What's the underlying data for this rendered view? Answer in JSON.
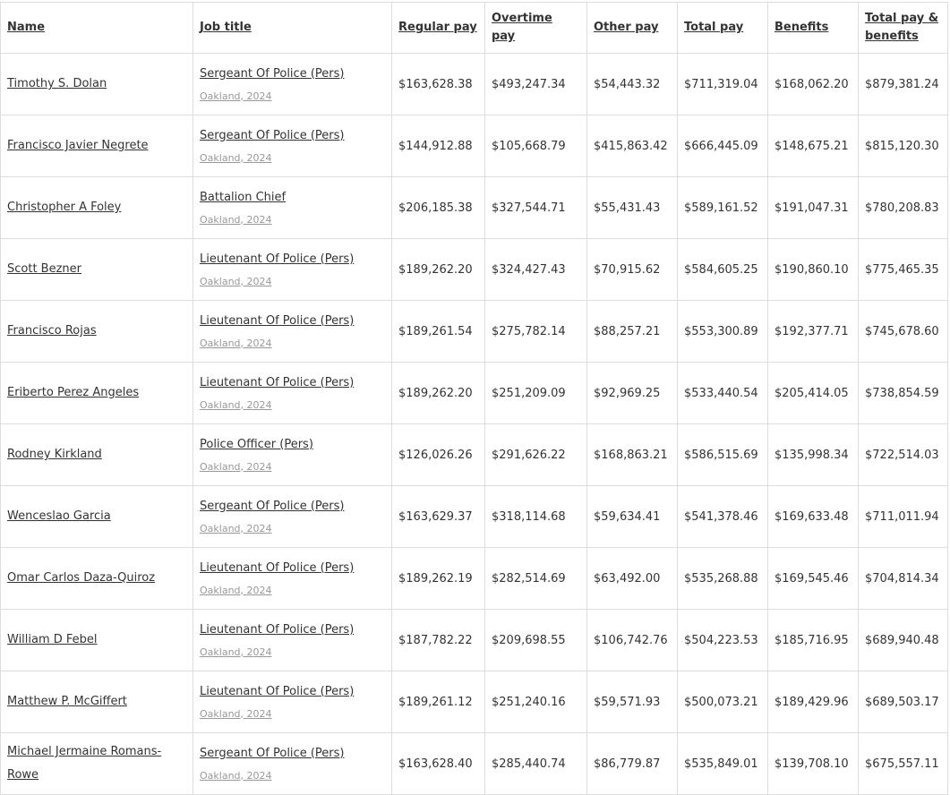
{
  "headers": {
    "name": "Name",
    "job_title": "Job title",
    "regular_pay": "Regular pay",
    "overtime_pay": "Overtime pay",
    "other_pay": "Other pay",
    "total_pay": "Total pay",
    "benefits": "Benefits",
    "total_pay_benefits": "Total pay & benefits"
  },
  "rows": [
    {
      "name": "Timothy S. Dolan",
      "job": "Sergeant Of Police (Pers)",
      "location": "Oakland, 2024",
      "regular": "$163,628.38",
      "overtime": "$493,247.34",
      "other": "$54,443.32",
      "total": "$711,319.04",
      "benefits": "$168,062.20",
      "total_benefits": "$879,381.24"
    },
    {
      "name": "Francisco Javier Negrete",
      "job": "Sergeant Of Police (Pers)",
      "location": "Oakland, 2024",
      "regular": "$144,912.88",
      "overtime": "$105,668.79",
      "other": "$415,863.42",
      "total": "$666,445.09",
      "benefits": "$148,675.21",
      "total_benefits": "$815,120.30"
    },
    {
      "name": "Christopher A Foley",
      "job": "Battalion Chief",
      "location": "Oakland, 2024",
      "regular": "$206,185.38",
      "overtime": "$327,544.71",
      "other": "$55,431.43",
      "total": "$589,161.52",
      "benefits": "$191,047.31",
      "total_benefits": "$780,208.83"
    },
    {
      "name": "Scott Bezner",
      "job": "Lieutenant Of Police (Pers)",
      "location": "Oakland, 2024",
      "regular": "$189,262.20",
      "overtime": "$324,427.43",
      "other": "$70,915.62",
      "total": "$584,605.25",
      "benefits": "$190,860.10",
      "total_benefits": "$775,465.35"
    },
    {
      "name": "Francisco Rojas",
      "job": "Lieutenant Of Police (Pers)",
      "location": "Oakland, 2024",
      "regular": "$189,261.54",
      "overtime": "$275,782.14",
      "other": "$88,257.21",
      "total": "$553,300.89",
      "benefits": "$192,377.71",
      "total_benefits": "$745,678.60"
    },
    {
      "name": "Eriberto Perez Angeles",
      "job": "Lieutenant Of Police (Pers)",
      "location": "Oakland, 2024",
      "regular": "$189,262.20",
      "overtime": "$251,209.09",
      "other": "$92,969.25",
      "total": "$533,440.54",
      "benefits": "$205,414.05",
      "total_benefits": "$738,854.59"
    },
    {
      "name": "Rodney Kirkland",
      "job": "Police Officer (Pers)",
      "location": "Oakland, 2024",
      "regular": "$126,026.26",
      "overtime": "$291,626.22",
      "other": "$168,863.21",
      "total": "$586,515.69",
      "benefits": "$135,998.34",
      "total_benefits": "$722,514.03"
    },
    {
      "name": "Wenceslao Garcia",
      "job": "Sergeant Of Police (Pers)",
      "location": "Oakland, 2024",
      "regular": "$163,629.37",
      "overtime": "$318,114.68",
      "other": "$59,634.41",
      "total": "$541,378.46",
      "benefits": "$169,633.48",
      "total_benefits": "$711,011.94"
    },
    {
      "name": "Omar Carlos Daza-Quiroz",
      "job": "Lieutenant Of Police (Pers)",
      "location": "Oakland, 2024",
      "regular": "$189,262.19",
      "overtime": "$282,514.69",
      "other": "$63,492.00",
      "total": "$535,268.88",
      "benefits": "$169,545.46",
      "total_benefits": "$704,814.34"
    },
    {
      "name": "William D Febel",
      "job": "Lieutenant Of Police (Pers)",
      "location": "Oakland, 2024",
      "regular": "$187,782.22",
      "overtime": "$209,698.55",
      "other": "$106,742.76",
      "total": "$504,223.53",
      "benefits": "$185,716.95",
      "total_benefits": "$689,940.48"
    },
    {
      "name": "Matthew P. McGiffert",
      "job": "Lieutenant Of Police (Pers)",
      "location": "Oakland, 2024",
      "regular": "$189,261.12",
      "overtime": "$251,240.16",
      "other": "$59,571.93",
      "total": "$500,073.21",
      "benefits": "$189,429.96",
      "total_benefits": "$689,503.17"
    },
    {
      "name": "Michael Jermaine Romans-Rowe",
      "job": "Sergeant Of Police (Pers)",
      "location": "Oakland, 2024",
      "regular": "$163,628.40",
      "overtime": "$285,440.74",
      "other": "$86,779.87",
      "total": "$535,849.01",
      "benefits": "$139,708.10",
      "total_benefits": "$675,557.11"
    }
  ]
}
